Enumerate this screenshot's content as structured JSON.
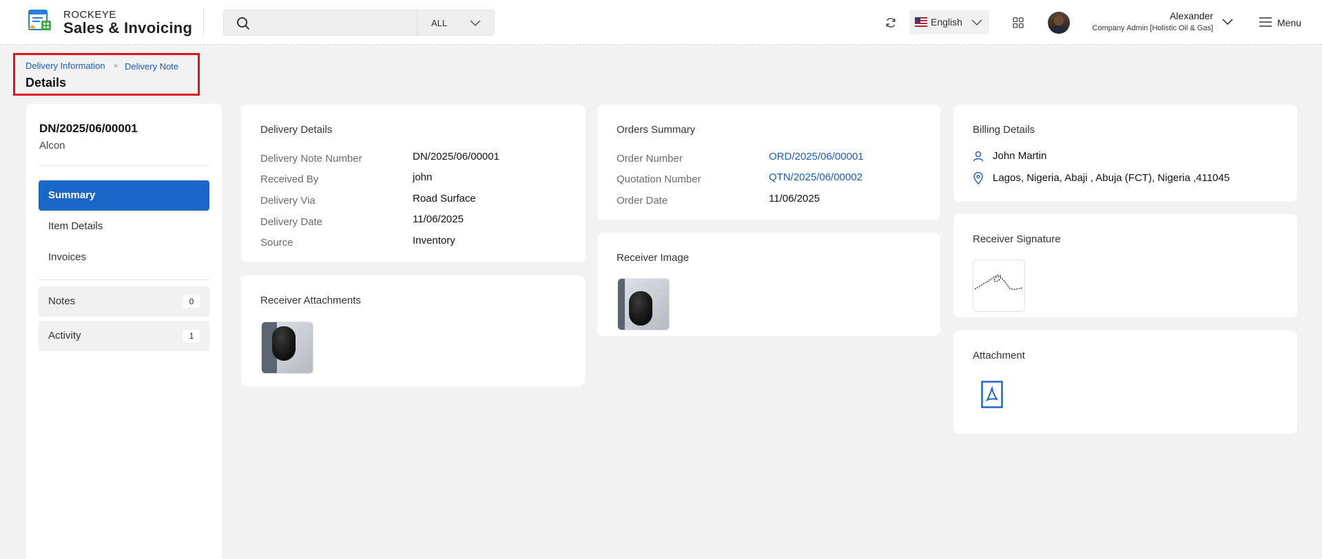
{
  "header": {
    "brand_top": "ROCKEYE",
    "brand_main": "Sales & Invoicing",
    "search_placeholder": "",
    "search_filter": "ALL",
    "language": "English",
    "user_name": "Alexander",
    "user_role": "Company Admin [Holistic Oil & Gas]",
    "menu_label": "Menu"
  },
  "breadcrumb": {
    "items": [
      "Delivery Information",
      "Delivery Note"
    ],
    "title": "Details"
  },
  "sidebar": {
    "doc_number": "DN/2025/06/00001",
    "doc_sub": "Alcon",
    "nav": [
      {
        "label": "Summary",
        "active": true
      },
      {
        "label": "Item Details",
        "active": false
      },
      {
        "label": "Invoices",
        "active": false
      }
    ],
    "notes": {
      "label": "Notes",
      "count": "0"
    },
    "activity": {
      "label": "Activity",
      "count": "1"
    }
  },
  "delivery_details": {
    "title": "Delivery Details",
    "rows": [
      {
        "label": "Delivery Note Number",
        "value": "DN/2025/06/00001"
      },
      {
        "label": "Received By",
        "value": "john"
      },
      {
        "label": "Delivery Via",
        "value": "Road Surface"
      },
      {
        "label": "Delivery Date",
        "value": "11/06/2025"
      },
      {
        "label": "Source",
        "value": "Inventory"
      }
    ]
  },
  "orders_summary": {
    "title": "Orders Summary",
    "rows": [
      {
        "label": "Order Number",
        "value": "ORD/2025/06/00001"
      },
      {
        "label": "Quotation Number",
        "value": "QTN/2025/06/00002"
      },
      {
        "label": "Order Date",
        "value": "11/06/2025"
      }
    ]
  },
  "billing_details": {
    "title": "Billing Details",
    "name": "John Martin",
    "address": "Lagos, Nigeria, Abaji , Abuja (FCT), Nigeria ,411045"
  },
  "receiver_attachments": {
    "title": "Receiver Attachments"
  },
  "receiver_image": {
    "title": "Receiver Image"
  },
  "receiver_signature": {
    "title": "Receiver Signature"
  },
  "attachment": {
    "title": "Attachment"
  },
  "colors": {
    "accent": "#1b66c9",
    "link": "#1a5ab8",
    "highlight_box": "#e0141c"
  }
}
